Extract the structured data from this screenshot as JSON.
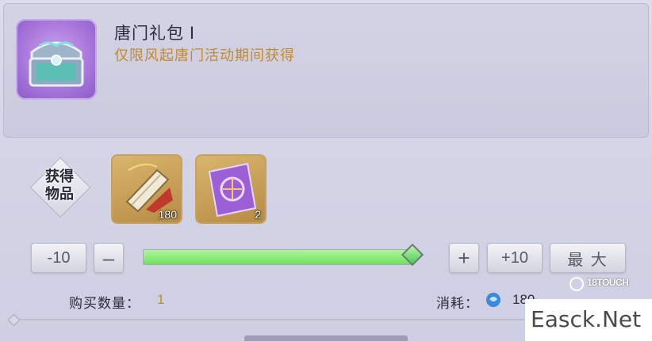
{
  "item": {
    "name": "唐门礼包 Ⅰ",
    "description": "仅限风起唐门活动期间获得",
    "icon": "treasure-chest-icon"
  },
  "rewards": {
    "badge_label": "获得\n物品",
    "items": [
      {
        "icon": "scroll-icon",
        "count": "180"
      },
      {
        "icon": "purple-card-icon",
        "count": "2"
      }
    ]
  },
  "controls": {
    "minus10_label": "-10",
    "minus_label": "–",
    "plus_label": "+",
    "plus10_label": "+10",
    "max_label": "最 大",
    "slider_fraction": 1.0
  },
  "summary": {
    "quantity_label": "购买数量：",
    "quantity_value": "1",
    "cost_label": "消耗：",
    "cost_icon": "blue-gem-icon",
    "cost_value": "180"
  },
  "watermark": {
    "logo_text": "18TOUCH",
    "site_text": "Easck.Net"
  },
  "colors": {
    "accent_gold": "#c38a2c",
    "slider_green": "#6fe05f"
  }
}
